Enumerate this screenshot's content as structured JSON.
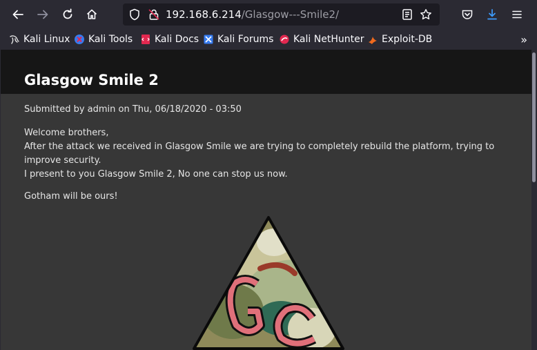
{
  "browser": {
    "url_host": "192.168.6.214",
    "url_path": "/Glasgow---Smile2/",
    "accent_color": "#0df",
    "download_color": "#3d9cff"
  },
  "bookmarks": [
    {
      "label": "Kali Linux",
      "icon": "kali-dragon-icon"
    },
    {
      "label": "Kali Tools",
      "icon": "kali-tools-icon"
    },
    {
      "label": "Kali Docs",
      "icon": "kali-docs-icon"
    },
    {
      "label": "Kali Forums",
      "icon": "kali-forums-icon"
    },
    {
      "label": "Kali NetHunter",
      "icon": "nethunter-icon"
    },
    {
      "label": "Exploit-DB",
      "icon": "exploit-db-icon"
    }
  ],
  "page": {
    "title": "Glasgow Smile 2",
    "submitted": "Submitted by admin on Thu, 06/18/2020 - 03:50",
    "lines": [
      "Welcome brothers,",
      "After the attack we received in Glasgow Smile we are trying to completely rebuild the platform, trying to improve security.",
      "I present to you Glasgow Smile 2, No one can stop us now."
    ],
    "closing": "Gotham will be ours!"
  }
}
